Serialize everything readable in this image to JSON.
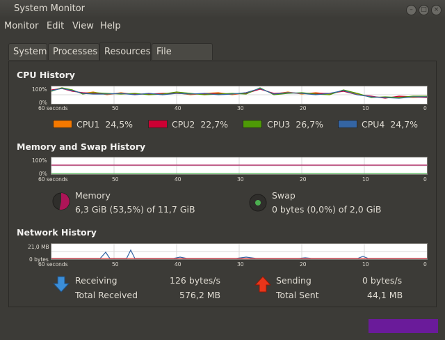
{
  "window": {
    "title": "System Monitor",
    "controls": {
      "close": "×",
      "minimize": "–",
      "maximize": "□"
    }
  },
  "menu": [
    "Monitor",
    "Edit",
    "View",
    "Help"
  ],
  "tabs": {
    "system": "System",
    "processes": "Processes",
    "resources": "Resources",
    "filesystems": "File Systems"
  },
  "cpu": {
    "title": "CPU History",
    "y_labels": {
      "top": "100%",
      "bottom": "0%"
    },
    "legend": [
      {
        "label": "CPU1",
        "value": "24,5%",
        "color": "#f57900"
      },
      {
        "label": "CPU2",
        "value": "22,7%",
        "color": "#cc0033"
      },
      {
        "label": "CPU3",
        "value": "26,7%",
        "color": "#4e9a06"
      },
      {
        "label": "CPU4",
        "value": "24,7%",
        "color": "#3465a4"
      }
    ]
  },
  "x_axis": [
    "60 seconds",
    "50",
    "40",
    "30",
    "20",
    "10",
    "0"
  ],
  "memory": {
    "title": "Memory and Swap History",
    "y_labels": {
      "top": "100%",
      "bottom": "0%"
    },
    "mem_label": "Memory",
    "mem_value": "6,3 GiB (53,5%) of 11,7 GiB",
    "mem_color": "#ad1457",
    "swap_label": "Swap",
    "swap_value": "0 bytes (0,0%) of 2,0 GiB",
    "swap_color": "#4caf50"
  },
  "network": {
    "title": "Network History",
    "y_labels": {
      "top": "21,0 MB",
      "bottom": "0 bytes"
    },
    "receiving_label": "Receiving",
    "receiving_value": "126 bytes/s",
    "total_received_label": "Total Received",
    "total_received_value": "576,2 MB",
    "sending_label": "Sending",
    "sending_value": "0 bytes/s",
    "total_sent_label": "Total Sent",
    "total_sent_value": "44,1 MB"
  }
}
